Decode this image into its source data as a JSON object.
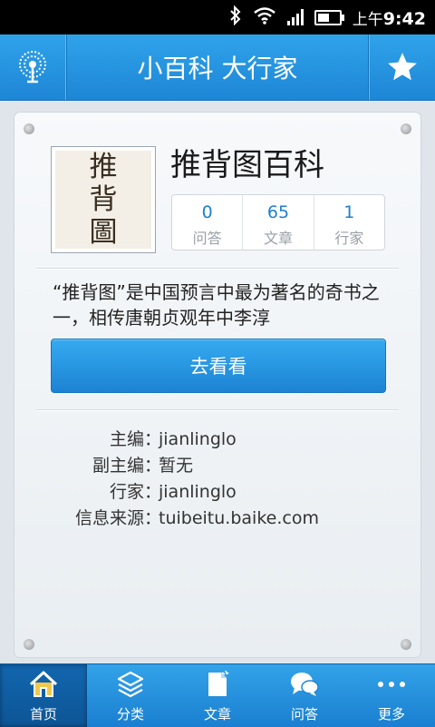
{
  "status_bar": {
    "time_prefix": "上午",
    "time": "9:42"
  },
  "header": {
    "title": "小百科 大行家",
    "left_icon": "tree-logo-icon",
    "right_icon": "star-icon"
  },
  "encyclopedia": {
    "thumbnail_text": [
      "推",
      "背",
      "圖"
    ],
    "title": "推背图百科",
    "stats": [
      {
        "value": "0",
        "label": "问答"
      },
      {
        "value": "65",
        "label": "文章"
      },
      {
        "value": "1",
        "label": "行家"
      }
    ],
    "description": "“推背图”是中国预言中最为著名的奇书之一，相传唐朝贞观年中李淳",
    "action_label": "去看看",
    "info": [
      {
        "key": "主编",
        "value": "jianlinglo"
      },
      {
        "key": "副主编",
        "value": "暂无"
      },
      {
        "key": "行家",
        "value": "jianlinglo"
      },
      {
        "key": "信息来源",
        "value": "tuibeitu.baike.com"
      }
    ],
    "separator": "："
  },
  "tabs": [
    {
      "label": "首页",
      "icon": "home-icon",
      "active": true
    },
    {
      "label": "分类",
      "icon": "layers-icon",
      "active": false
    },
    {
      "label": "文章",
      "icon": "document-icon",
      "active": false
    },
    {
      "label": "问答",
      "icon": "chat-bubbles-icon",
      "active": false
    },
    {
      "label": "更多",
      "icon": "more-dots-icon",
      "active": false
    }
  ],
  "colors": {
    "accent": "#1e86d6",
    "stat_number": "#1e7fd0"
  }
}
